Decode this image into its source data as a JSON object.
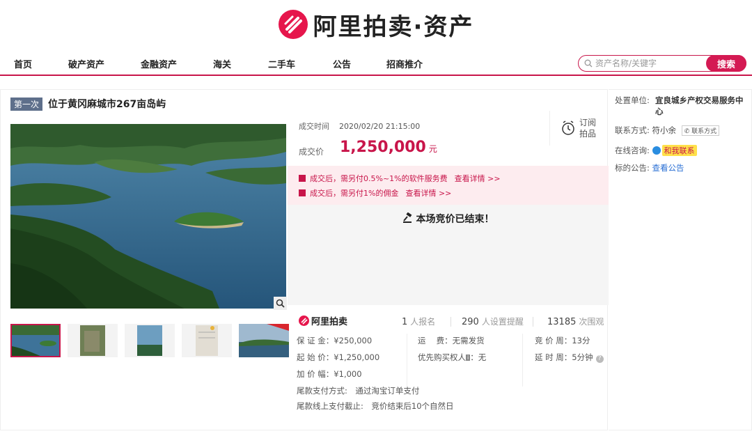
{
  "brand": {
    "name": "阿里拍卖·资产"
  },
  "nav": {
    "items": [
      "首页",
      "破产资产",
      "金融资产",
      "海关",
      "二手车",
      "公告",
      "招商推介"
    ]
  },
  "search": {
    "placeholder": "资产名称/关键字",
    "button": "搜索"
  },
  "auction": {
    "round": "第一次",
    "title": "位于黄冈麻城市267亩岛屿",
    "deal_time_label": "成交时间",
    "deal_time": "2020/02/20 21:15:00",
    "price_label": "成交价",
    "price": "1,250,000",
    "price_unit": "元",
    "subscribe_line1": "订阅",
    "subscribe_line2": "拍品",
    "notice1": "成交后，需另付0.5%~1%的软件服务费",
    "notice1_link": "查看详情 >>",
    "notice2": "成交后，需另付1%的佣金",
    "notice2_link": "查看详情 >>",
    "ended": "本场竞价已结束！",
    "logo_text": "阿里拍卖",
    "stats": {
      "signups": "1",
      "signups_label": "人报名",
      "reminders": "290",
      "reminders_label": "人设置提醒",
      "views": "13185",
      "views_label": "次围观"
    },
    "terms": {
      "deposit": "保 证 金：¥250,000",
      "start_price": "起 始 价：¥1,250,000",
      "increment": "加 价 幅：¥1,000",
      "shipping": "运　 费：无需发货",
      "priority_label": "优先购买权人",
      "priority_value": "：无",
      "cycle": "竞 价 周：13分",
      "extend": "延 时 周：5分钟",
      "payment_method": "尾款支付方式:　通过淘宝订单支付",
      "payment_deadline": "尾款线上支付截止:　竞价结束后10个自然日"
    }
  },
  "sidebar": {
    "unit_label": "处置单位:",
    "unit_value": "宜良城乡产权交易服务中心",
    "contact_label": "联系方式:",
    "contact_value": "符小余",
    "contact_btn": "联系方式",
    "consult_label": "在线咨询:",
    "consult_btn": "和我联系",
    "announce_label": "标的公告:",
    "announce_link": "查看公告"
  },
  "colors": {
    "brand_red": "#c8154a",
    "badge_blue": "#5e6f8b",
    "link_blue": "#2a6fd4"
  }
}
